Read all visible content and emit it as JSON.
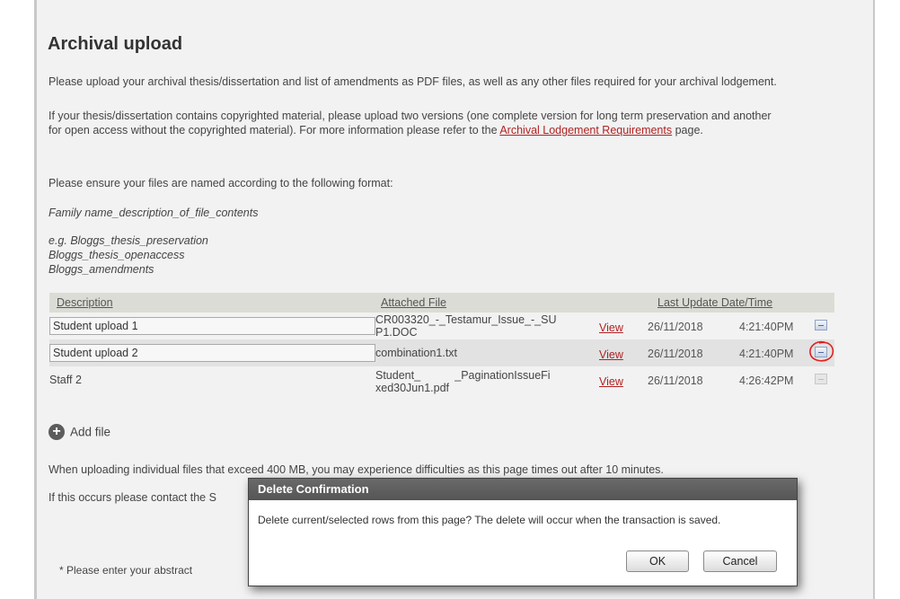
{
  "page": {
    "title": "Archival upload",
    "intro": "Please upload your archival thesis/dissertation and list of amendments as PDF files, as well as any other files required for your archival lodgement.",
    "copyright_pre": "If your thesis/dissertation contains copyrighted material, please upload two versions (one complete version for long term preservation and another for open access without the copyrighted material). For more information please refer to the ",
    "copyright_link": "Archival Lodgement Requirements",
    "copyright_post": " page.",
    "naming_intro": "Please ensure your files are named according to the following format:",
    "naming_format": "Family name_description_of_file_contents",
    "examples": [
      "e.g. Bloggs_thesis_preservation",
      "Bloggs_thesis_openaccess",
      "Bloggs_amendments"
    ],
    "timeout_note": "When uploading individual files that exceed 400 MB, you may experience difficulties as this page times out after 10 minutes.",
    "contact_note": "If this occurs please contact the S",
    "abstract_label": "* Please enter your abstract"
  },
  "grid": {
    "headers": {
      "description": "Description",
      "file": "Attached File",
      "updated": "Last Update Date/Time"
    },
    "rows": [
      {
        "description": "Student upload 1",
        "file_line1": "CR003320_-_Testamur_Issue_-_SU",
        "file_line2": "P1.DOC",
        "view": "View",
        "date": "26/11/2018",
        "time": "4:21:40PM"
      },
      {
        "description": "Student upload 2",
        "file": "combination1.txt",
        "view": "View",
        "date": "26/11/2018",
        "time": "4:21:40PM"
      },
      {
        "description": "Staff 2",
        "file_line1": "Student_           _PaginationIssueFi",
        "file_line2": "xed30Jun1.pdf",
        "view": "View",
        "date": "26/11/2018",
        "time": "4:26:42PM"
      }
    ]
  },
  "actions": {
    "add_file": "Add file",
    "add_icon": "+"
  },
  "dialog": {
    "title": "Delete Confirmation",
    "message": "Delete current/selected rows from this page? The delete will occur when the transaction is saved.",
    "ok": "OK",
    "cancel": "Cancel"
  },
  "colors": {
    "link": "#b02222",
    "annotation": "#e02020",
    "dialog_header": "#5e5e5e"
  }
}
